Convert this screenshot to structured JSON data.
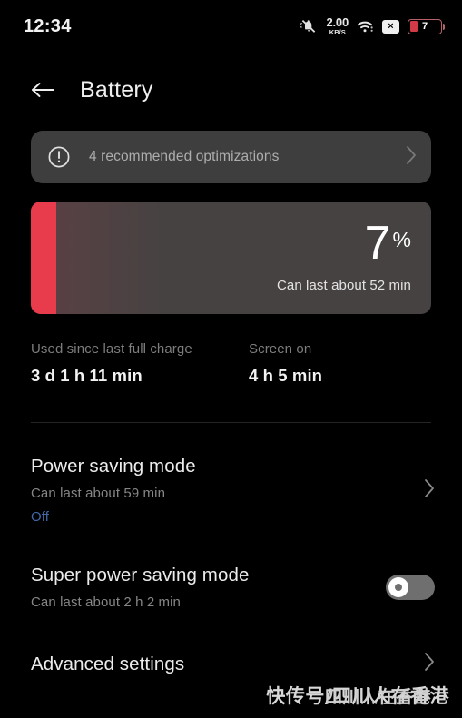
{
  "status_bar": {
    "clock": "12:34",
    "notification_icon": "bell-muted-icon",
    "network_speed_value": "2.00",
    "network_speed_unit": "KB/S",
    "wifi_icon": "wifi-icon",
    "x_badge_label": "×",
    "battery_level_label": "7"
  },
  "header": {
    "back_icon": "back-arrow-icon",
    "title": "Battery"
  },
  "optimization_banner": {
    "icon": "exclamation-circle-icon",
    "label": "4 recommended optimizations",
    "chevron": "chevron-right-icon"
  },
  "battery_card": {
    "percent_number": "7",
    "percent_symbol": "%",
    "estimate": "Can last about 52 min",
    "fill_percent": 7,
    "accent_color": "#e83c4c",
    "card_color": "#464242"
  },
  "stats": [
    {
      "label": "Used since last full charge",
      "value": "3 d 1 h 11 min"
    },
    {
      "label": "Screen on",
      "value": "4 h 5 min"
    }
  ],
  "settings_rows": {
    "power_saving": {
      "title": "Power saving mode",
      "subtitle": "Can last about 59 min",
      "state": "Off",
      "state_color": "#4169a8",
      "chevron": "chevron-right-icon"
    },
    "super_power_saving": {
      "title": "Super power saving mode",
      "subtitle": "Can last about 2 h 2 min",
      "toggle_on": false
    },
    "advanced_settings": {
      "title": "Advanced settings",
      "chevron": "chevron-right-icon"
    }
  },
  "watermark": {
    "text": "快传号/四川人在香港",
    "overlay_text": "四川人在香港"
  }
}
